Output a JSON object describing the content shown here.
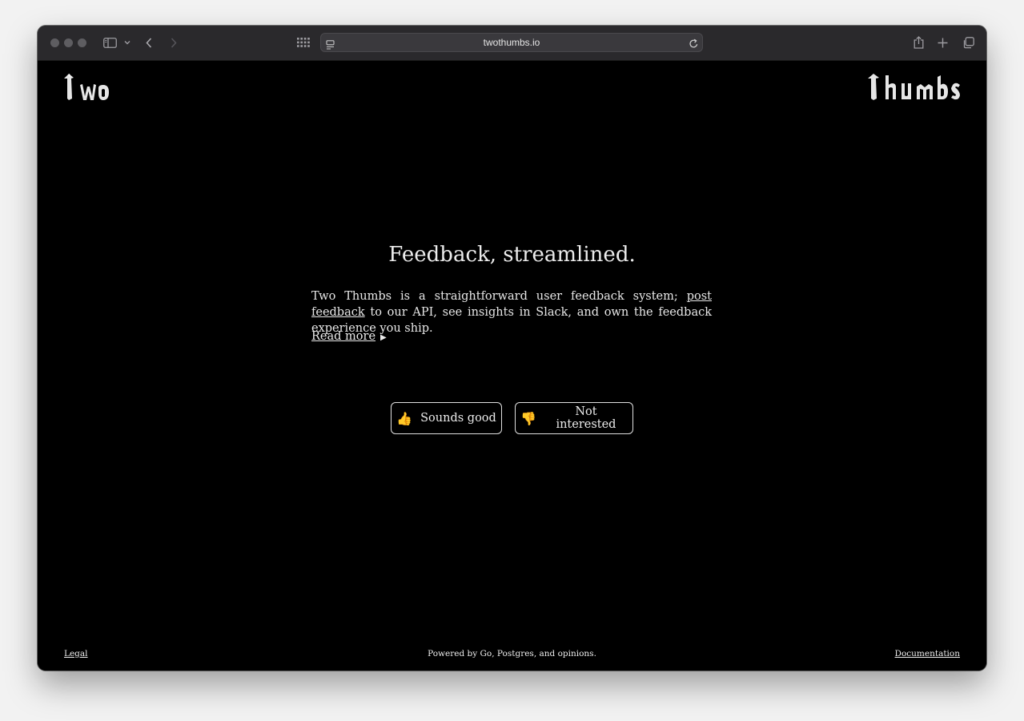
{
  "browser": {
    "url": "twothumbs.io"
  },
  "header": {
    "logo_left": "Two",
    "logo_right": "Thumbs"
  },
  "hero": {
    "title": "Feedback, streamlined.",
    "intro_before": "Two Thumbs is a straightforward user feedback system; ",
    "intro_link": "post feedback",
    "intro_after": " to our API, see insights in Slack, and own the feedback experience you ship.",
    "read_more": "Read more",
    "read_more_marker": "▶"
  },
  "actions": {
    "yes_emoji": "👍",
    "yes_label": "Sounds good",
    "no_emoji": "👎",
    "no_label": "Not interested"
  },
  "footer": {
    "legal": "Legal",
    "powered": "Powered by Go, Postgres, and opinions.",
    "docs": "Documentation"
  }
}
